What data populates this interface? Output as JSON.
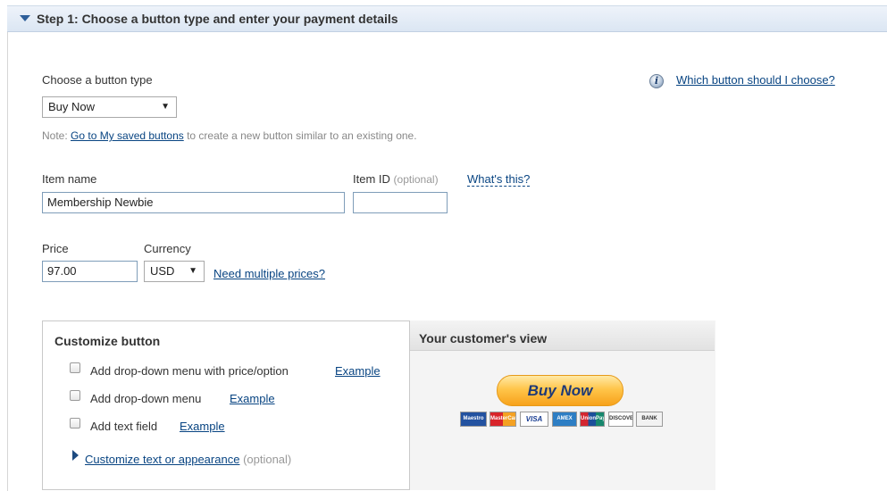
{
  "step": {
    "title": "Step 1: Choose a button type and enter your payment details"
  },
  "button_type": {
    "label": "Choose a button type",
    "selected": "Buy Now",
    "help_link": "Which button should I choose?"
  },
  "note": {
    "prefix": "Note: ",
    "link": "Go to My saved buttons",
    "suffix": " to create a new button similar to an existing one."
  },
  "item": {
    "name_label": "Item name",
    "name_value": "Membership Newbie",
    "id_label": "Item ID",
    "id_optional": "(optional)",
    "id_help": "What's this?",
    "id_value": ""
  },
  "price": {
    "label": "Price",
    "value": "97.00",
    "currency_label": "Currency",
    "currency_value": "USD",
    "multiple_link": "Need multiple prices?"
  },
  "customize": {
    "title": "Customize button",
    "options": [
      {
        "label": "Add drop-down menu with price/option",
        "link": "Example",
        "checked": false
      },
      {
        "label": "Add drop-down menu",
        "link": "Example",
        "checked": false
      },
      {
        "label": "Add text field",
        "link": "Example",
        "checked": false
      }
    ],
    "appearance_link": "Customize text or appearance",
    "appearance_optional": "(optional)"
  },
  "preview": {
    "title": "Your customer's view",
    "button_label": "Buy Now",
    "cards": [
      "Maestro",
      "MasterCard",
      "VISA",
      "AMEX",
      "UnionPay",
      "DISCOVER",
      "BANK"
    ]
  },
  "colors": {
    "link": "#084482",
    "header_bg": "#dbe6f3",
    "buynow_gold": "#ffc54a"
  }
}
